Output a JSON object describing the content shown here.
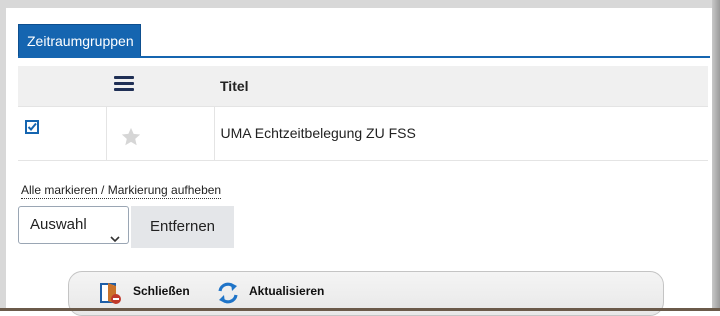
{
  "tab": {
    "label": "Zeitraumgruppen"
  },
  "table": {
    "header": {
      "title": "Titel"
    },
    "rows": [
      {
        "checked": true,
        "favorite": false,
        "title": "UMA Echtzeitbelegung ZU FSS"
      }
    ]
  },
  "selection": {
    "link_label": "Alle markieren / Markierung aufheben"
  },
  "actions": {
    "select_value": "Auswahl",
    "remove_label": "Entfernen"
  },
  "toolbar": {
    "close_label": "Schließen",
    "refresh_label": "Aktualisieren"
  },
  "icons": {
    "menu": "menu-icon",
    "checkbox": "checkbox-checked-icon",
    "star": "star-icon",
    "close": "close-door-icon",
    "refresh": "refresh-icon"
  },
  "colors": {
    "accent": "#1565b0",
    "header_bg": "#f0f0f0",
    "button_bg": "#e4e6e9"
  }
}
